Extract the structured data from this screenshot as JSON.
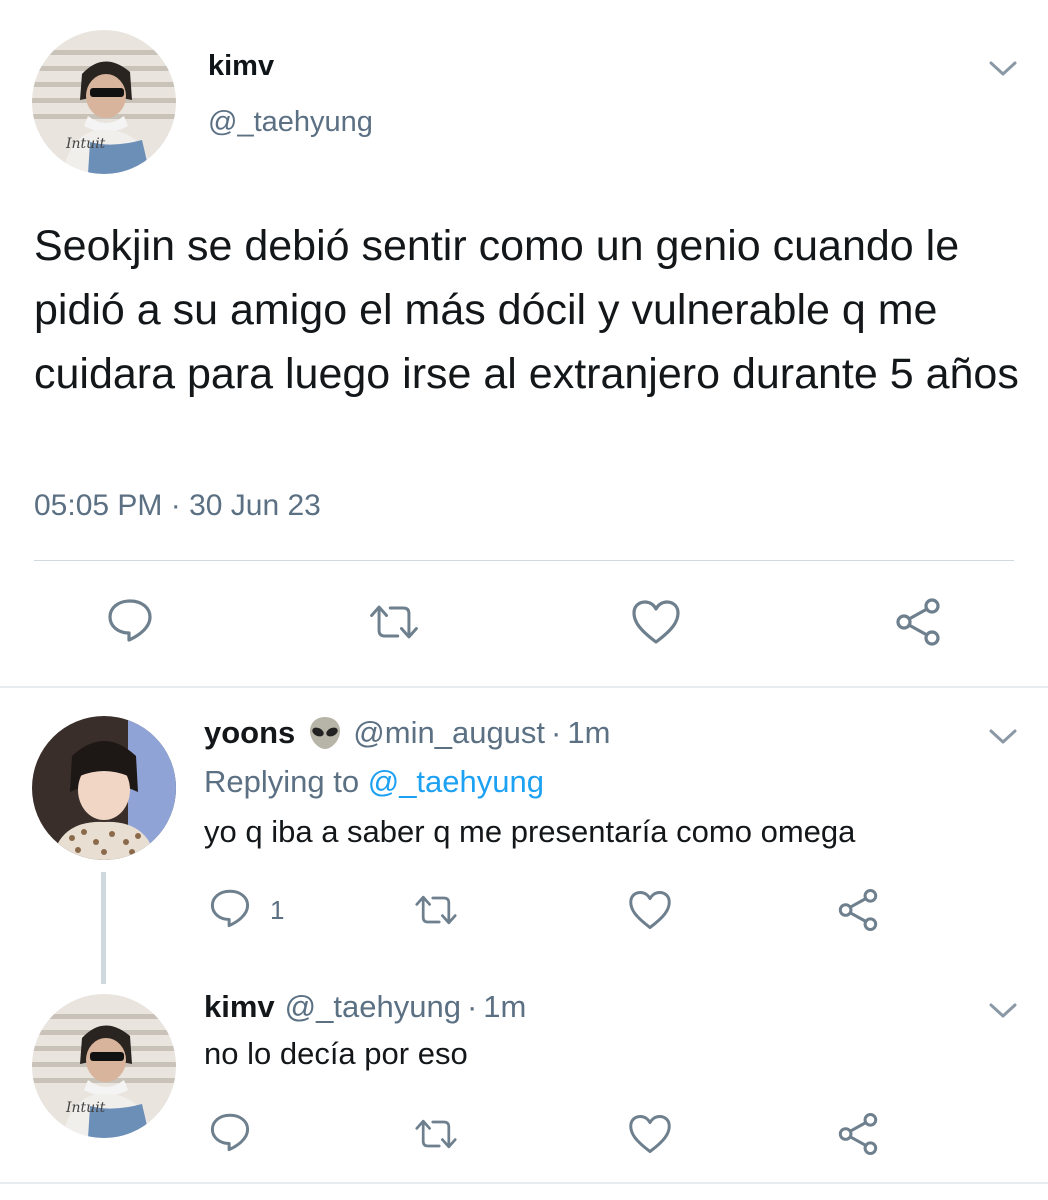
{
  "main_tweet": {
    "author_name": "kimv",
    "author_handle": "@_taehyung",
    "text": "Seokjin se debió sentir como un genio cuando le pidió a su amigo el más dócil y vulnerable q me cuidara para luego irse al extranjero durante 5 años",
    "timestamp": "05:05 PM · 30 Jun 23"
  },
  "replies": [
    {
      "author_name": "yoons",
      "emoji": "alien-icon",
      "author_handle": "@min_august",
      "separator": "·",
      "time": "1m",
      "replying_label": "Replying to",
      "replying_to": "@_taehyung",
      "text": "yo q iba a saber q me presentaría como omega",
      "reply_count": "1"
    },
    {
      "author_name": "kimv",
      "author_handle": "@_taehyung",
      "separator": "·",
      "time": "1m",
      "text": "no lo decía por eso"
    }
  ],
  "colors": {
    "accent": "#1da1f2",
    "muted": "#5b7083",
    "icon": "#6e7f8d",
    "divider": "#cfd9de"
  }
}
